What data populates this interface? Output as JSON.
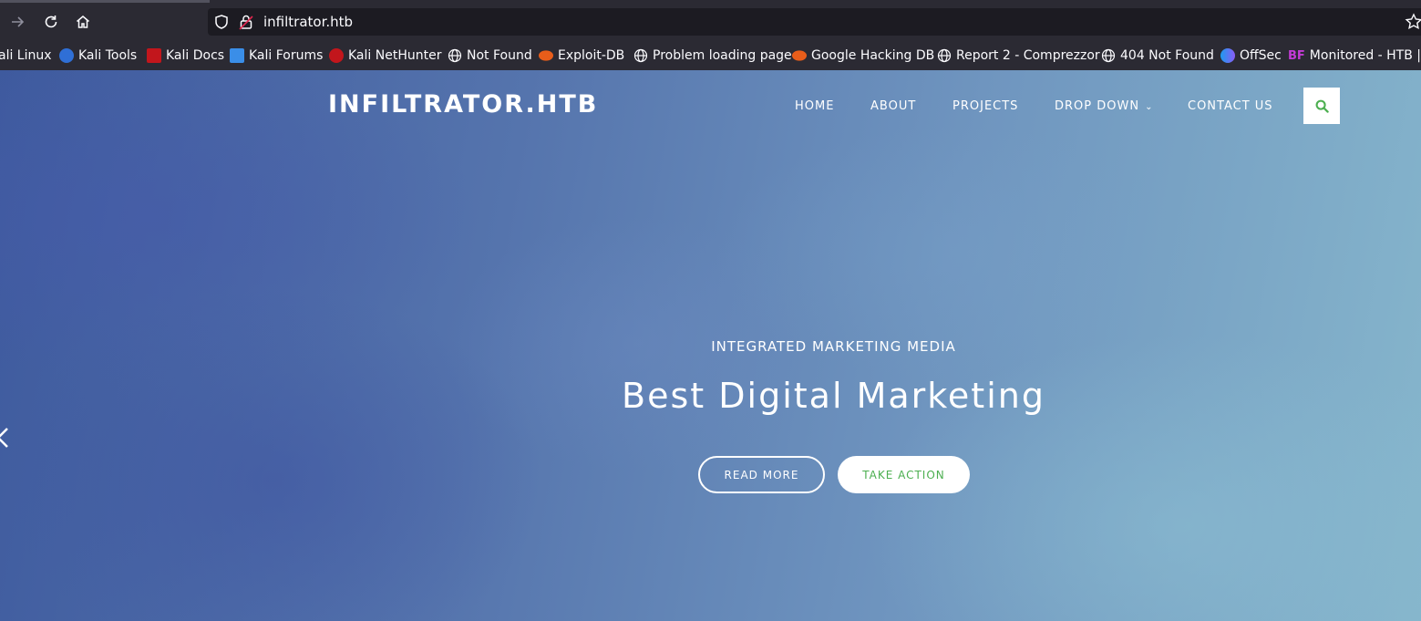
{
  "browser": {
    "url": "infiltrator.htb",
    "bookmarks": [
      {
        "label": "ali Linux",
        "icon": "none"
      },
      {
        "label": "Kali Tools",
        "icon": "kali-icon"
      },
      {
        "label": "Kali Docs",
        "icon": "kali-docs-icon"
      },
      {
        "label": "Kali Forums",
        "icon": "kali-forums-icon"
      },
      {
        "label": "Kali NetHunter",
        "icon": "nethunter-icon"
      },
      {
        "label": "Not Found",
        "icon": "globe-icon"
      },
      {
        "label": "Exploit-DB",
        "icon": "exploit-db-icon"
      },
      {
        "label": "Problem loading page",
        "icon": "globe-icon"
      },
      {
        "label": "Google Hacking DB",
        "icon": "exploit-db-icon"
      },
      {
        "label": "Report 2 - Comprezzor",
        "icon": "globe-icon"
      },
      {
        "label": "404 Not Found",
        "icon": "globe-icon"
      },
      {
        "label": "OffSec",
        "icon": "offsec-icon"
      },
      {
        "label": "Monitored - HTB | E",
        "icon": "bf-icon",
        "icon_text": "BF"
      }
    ]
  },
  "site": {
    "brand": "INFILTRATOR.HTB",
    "nav": {
      "home": "HOME",
      "about": "ABOUT",
      "projects": "PROJECTS",
      "dropdown": "DROP DOWN",
      "contact": "CONTACT US"
    },
    "accent_color": "#4caf50"
  },
  "hero": {
    "subtitle": "INTEGRATED MARKETING MEDIA",
    "title": "Best Digital Marketing",
    "read_more": "READ MORE",
    "take_action": "TAKE ACTION"
  }
}
